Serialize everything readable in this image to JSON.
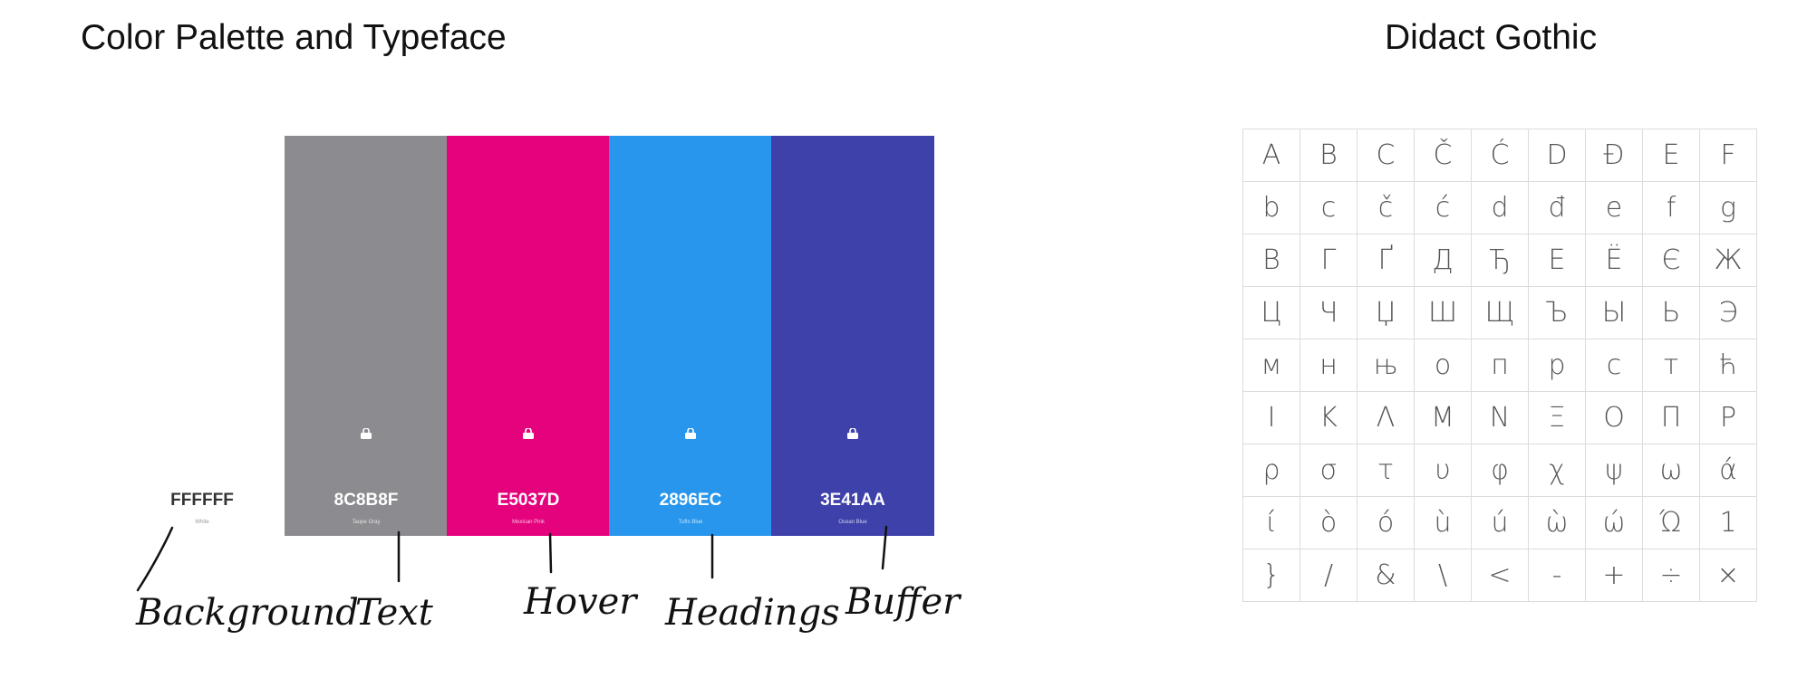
{
  "palette_title": "Color Palette and Typeface",
  "typeface_title": "Didact Gothic",
  "background_swatch": {
    "hex": "FFFFFF",
    "caption": "White",
    "annotation": "Background",
    "color": "#FFFFFF"
  },
  "swatches": [
    {
      "hex": "8C8B8F",
      "caption": "Taupe Gray",
      "annotation": "Text",
      "color": "#8C8B8F"
    },
    {
      "hex": "E5037D",
      "caption": "Mexican Pink",
      "annotation": "Hover",
      "color": "#E5037D"
    },
    {
      "hex": "2896EC",
      "caption": "Tufts Blue",
      "annotation": "Headings",
      "color": "#2896EC"
    },
    {
      "hex": "3E41AA",
      "caption": "Ocean Blue",
      "annotation": "Buffer",
      "color": "#3E41AA"
    }
  ],
  "swatch_icon": "lock-icon",
  "glyph_rows": [
    [
      "A",
      "B",
      "C",
      "Č",
      "Ć",
      "D",
      "Đ",
      "E",
      "F"
    ],
    [
      "b",
      "c",
      "č",
      "ć",
      "d",
      "đ",
      "e",
      "f",
      "g"
    ],
    [
      "В",
      "Г",
      "Ґ",
      "Д",
      "Ђ",
      "Е",
      "Ё",
      "Є",
      "Ж"
    ],
    [
      "Ц",
      "Ч",
      "Џ",
      "Ш",
      "Щ",
      "Ъ",
      "Ы",
      "Ь",
      "Э"
    ],
    [
      "м",
      "н",
      "њ",
      "о",
      "п",
      "р",
      "с",
      "т",
      "ћ"
    ],
    [
      "Ι",
      "Κ",
      "Λ",
      "Μ",
      "Ν",
      "Ξ",
      "Ο",
      "Π",
      "Ρ"
    ],
    [
      "ρ",
      "σ",
      "τ",
      "υ",
      "φ",
      "χ",
      "ψ",
      "ω",
      "ά"
    ],
    [
      "ί",
      "ò",
      "ó",
      "ù",
      "ú",
      "ὼ",
      "ώ",
      "Ώ",
      "1"
    ],
    [
      "}",
      "/",
      "&",
      "\\",
      "<",
      "-",
      "+",
      "÷",
      "×"
    ]
  ]
}
